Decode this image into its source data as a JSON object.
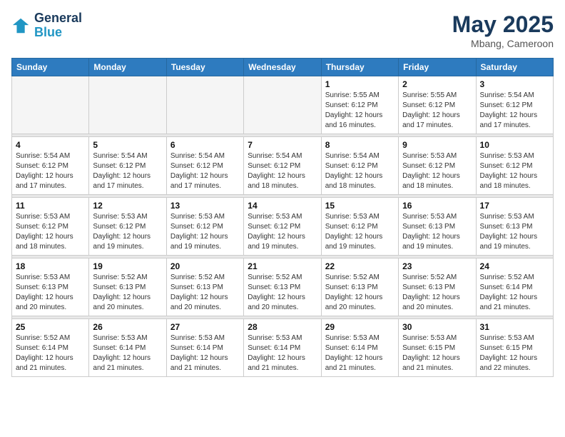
{
  "header": {
    "logo_line1": "General",
    "logo_line2": "Blue",
    "month_year": "May 2025",
    "location": "Mbang, Cameroon"
  },
  "days_of_week": [
    "Sunday",
    "Monday",
    "Tuesday",
    "Wednesday",
    "Thursday",
    "Friday",
    "Saturday"
  ],
  "weeks": [
    [
      {
        "day": "",
        "empty": true
      },
      {
        "day": "",
        "empty": true
      },
      {
        "day": "",
        "empty": true
      },
      {
        "day": "",
        "empty": true
      },
      {
        "day": "1",
        "sunrise": "5:55 AM",
        "sunset": "6:12 PM",
        "daylight": "12 hours and 16 minutes."
      },
      {
        "day": "2",
        "sunrise": "5:55 AM",
        "sunset": "6:12 PM",
        "daylight": "12 hours and 17 minutes."
      },
      {
        "day": "3",
        "sunrise": "5:54 AM",
        "sunset": "6:12 PM",
        "daylight": "12 hours and 17 minutes."
      }
    ],
    [
      {
        "day": "4",
        "sunrise": "5:54 AM",
        "sunset": "6:12 PM",
        "daylight": "12 hours and 17 minutes."
      },
      {
        "day": "5",
        "sunrise": "5:54 AM",
        "sunset": "6:12 PM",
        "daylight": "12 hours and 17 minutes."
      },
      {
        "day": "6",
        "sunrise": "5:54 AM",
        "sunset": "6:12 PM",
        "daylight": "12 hours and 17 minutes."
      },
      {
        "day": "7",
        "sunrise": "5:54 AM",
        "sunset": "6:12 PM",
        "daylight": "12 hours and 18 minutes."
      },
      {
        "day": "8",
        "sunrise": "5:54 AM",
        "sunset": "6:12 PM",
        "daylight": "12 hours and 18 minutes."
      },
      {
        "day": "9",
        "sunrise": "5:53 AM",
        "sunset": "6:12 PM",
        "daylight": "12 hours and 18 minutes."
      },
      {
        "day": "10",
        "sunrise": "5:53 AM",
        "sunset": "6:12 PM",
        "daylight": "12 hours and 18 minutes."
      }
    ],
    [
      {
        "day": "11",
        "sunrise": "5:53 AM",
        "sunset": "6:12 PM",
        "daylight": "12 hours and 18 minutes."
      },
      {
        "day": "12",
        "sunrise": "5:53 AM",
        "sunset": "6:12 PM",
        "daylight": "12 hours and 19 minutes."
      },
      {
        "day": "13",
        "sunrise": "5:53 AM",
        "sunset": "6:12 PM",
        "daylight": "12 hours and 19 minutes."
      },
      {
        "day": "14",
        "sunrise": "5:53 AM",
        "sunset": "6:12 PM",
        "daylight": "12 hours and 19 minutes."
      },
      {
        "day": "15",
        "sunrise": "5:53 AM",
        "sunset": "6:12 PM",
        "daylight": "12 hours and 19 minutes."
      },
      {
        "day": "16",
        "sunrise": "5:53 AM",
        "sunset": "6:13 PM",
        "daylight": "12 hours and 19 minutes."
      },
      {
        "day": "17",
        "sunrise": "5:53 AM",
        "sunset": "6:13 PM",
        "daylight": "12 hours and 19 minutes."
      }
    ],
    [
      {
        "day": "18",
        "sunrise": "5:53 AM",
        "sunset": "6:13 PM",
        "daylight": "12 hours and 20 minutes."
      },
      {
        "day": "19",
        "sunrise": "5:52 AM",
        "sunset": "6:13 PM",
        "daylight": "12 hours and 20 minutes."
      },
      {
        "day": "20",
        "sunrise": "5:52 AM",
        "sunset": "6:13 PM",
        "daylight": "12 hours and 20 minutes."
      },
      {
        "day": "21",
        "sunrise": "5:52 AM",
        "sunset": "6:13 PM",
        "daylight": "12 hours and 20 minutes."
      },
      {
        "day": "22",
        "sunrise": "5:52 AM",
        "sunset": "6:13 PM",
        "daylight": "12 hours and 20 minutes."
      },
      {
        "day": "23",
        "sunrise": "5:52 AM",
        "sunset": "6:13 PM",
        "daylight": "12 hours and 20 minutes."
      },
      {
        "day": "24",
        "sunrise": "5:52 AM",
        "sunset": "6:14 PM",
        "daylight": "12 hours and 21 minutes."
      }
    ],
    [
      {
        "day": "25",
        "sunrise": "5:52 AM",
        "sunset": "6:14 PM",
        "daylight": "12 hours and 21 minutes."
      },
      {
        "day": "26",
        "sunrise": "5:53 AM",
        "sunset": "6:14 PM",
        "daylight": "12 hours and 21 minutes."
      },
      {
        "day": "27",
        "sunrise": "5:53 AM",
        "sunset": "6:14 PM",
        "daylight": "12 hours and 21 minutes."
      },
      {
        "day": "28",
        "sunrise": "5:53 AM",
        "sunset": "6:14 PM",
        "daylight": "12 hours and 21 minutes."
      },
      {
        "day": "29",
        "sunrise": "5:53 AM",
        "sunset": "6:14 PM",
        "daylight": "12 hours and 21 minutes."
      },
      {
        "day": "30",
        "sunrise": "5:53 AM",
        "sunset": "6:15 PM",
        "daylight": "12 hours and 21 minutes."
      },
      {
        "day": "31",
        "sunrise": "5:53 AM",
        "sunset": "6:15 PM",
        "daylight": "12 hours and 22 minutes."
      }
    ]
  ]
}
